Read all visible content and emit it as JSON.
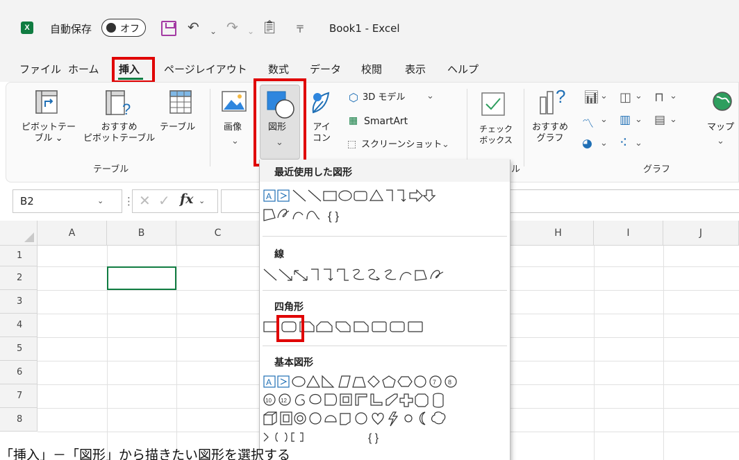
{
  "titlebar": {
    "app_logo": "X",
    "autosave_label": "自動保存",
    "autosave_toggle": "オフ",
    "title": "Book1 - Excel",
    "icons": [
      "excel-logo-icon",
      "save-icon",
      "undo-icon",
      "redo-icon",
      "paste-icon",
      "customize-quick-access-icon"
    ]
  },
  "menu": {
    "tabs": [
      "ファイル",
      "ホーム",
      "挿入",
      "ページレイアウト",
      "数式",
      "データ",
      "校閲",
      "表示",
      "ヘルプ"
    ],
    "active_tab": "挿入"
  },
  "ribbon": {
    "pivot_table": "ピボットテー\nブル ⌄",
    "recommended_pivot": "おすすめ\nピボットテーブル",
    "table": "テーブル",
    "group_table": "テーブル",
    "image": "画像",
    "shapes": "図形",
    "icons": "アイ\nコン",
    "model3d": "3D モデル",
    "smartart": "SmartArt",
    "screenshot": "スクリーンショット",
    "checkbox": "チェック\nボックス",
    "group_checkbox_tail": "ル",
    "recommended_chart": "おすすめ\nグラフ",
    "map": "マップ",
    "group_chart": "グラフ",
    "caret": "⌄",
    "help_mark": "?"
  },
  "formulabar": {
    "name_box": "B2",
    "more": "⋮",
    "cancel": "✕",
    "enter": "✓",
    "fx": "fx"
  },
  "grid": {
    "columns": [
      "A",
      "B",
      "C",
      "H",
      "I",
      "J"
    ],
    "rows": [
      "1",
      "2",
      "3",
      "4",
      "5",
      "6",
      "7",
      "8"
    ]
  },
  "shapes_menu": {
    "recent": "最近使用した図形",
    "lines": "線",
    "rectangles": "四角形",
    "basic": "基本図形",
    "recent_row2_brace": "{ }",
    "basic_last_brace": "{ }"
  },
  "caption": "「挿入」－「図形」から描きたい図形を選択する",
  "colors": {
    "excel_green": "#107c41",
    "highlight_red": "#e00000",
    "save_purple": "#a33aa3",
    "accent_blue": "#1f6fb5"
  }
}
